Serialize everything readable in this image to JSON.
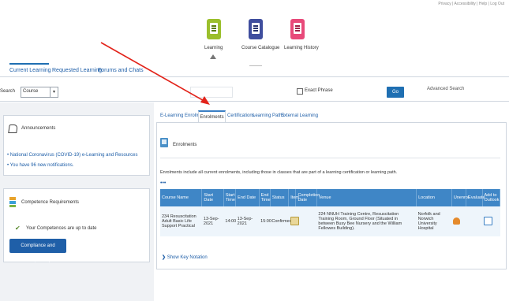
{
  "top_right_text": "Privacy | Accessibility | Help | Log Out",
  "apps": [
    {
      "label": "Learning",
      "color": "#9bbf2c",
      "line": "#5b7d12"
    },
    {
      "label": "Course Catalogue",
      "color": "#3f4e9e",
      "line": "#2a3570"
    },
    {
      "label": "Learning History",
      "color": "#e84a7a",
      "line": "#9e2348"
    }
  ],
  "nav_tabs": [
    "Current Learning",
    "Requested Learning",
    "Forums and Chats"
  ],
  "search": {
    "label": "Search",
    "scope": "Course",
    "exact_phrase": "Exact Phrase",
    "go": "Go",
    "advanced": "Advanced Search"
  },
  "left": {
    "announcements_title": "Announcements",
    "announcement_links": [
      "National Coronavirus (COVID-19) e-Learning and Resources",
      "You have 96 new notifications."
    ],
    "competence_title": "Competence Requirements",
    "competence_status": "Your Competences are up to date",
    "compliance_button": "Compliance and Competency"
  },
  "sub_tabs": [
    "E-Learning Enrolments",
    "Enrolments",
    "Certifications",
    "Learning Paths",
    "External Learning"
  ],
  "enrolments": {
    "title": "Enrolments",
    "description": "Enrolments include all current enrolments, including those in classes that are part of a learning certification or learning path.",
    "columns": [
      "Course Name",
      "Start Date",
      "Start Time",
      "End Date",
      "End Time",
      "Status",
      "Item",
      "Completion Date",
      "Venue",
      "Location",
      "Unenrol",
      "Evaluate",
      "Add to Outlook"
    ],
    "rows": [
      {
        "course": "234 Resuscitation Adult Basic Life Support Practical",
        "start_date": "13-Sep-2021",
        "start_time": "14:00",
        "end_date": "13-Sep-2021",
        "end_time": "15:00",
        "status": "Confirmed",
        "completion": "",
        "venue": "224 NNUH Training Centre, Resuscitation Training Room, Ground Floor (Situated in between Busy Bee Nursery and the William Fellowes Building).",
        "location": "Norfolk and Norwich University Hospital"
      }
    ],
    "show_key": "Show Key Notation"
  },
  "colors": {
    "accent": "#1f5fa8",
    "table_header": "#3f86c6",
    "arrow": "#e2231a"
  }
}
